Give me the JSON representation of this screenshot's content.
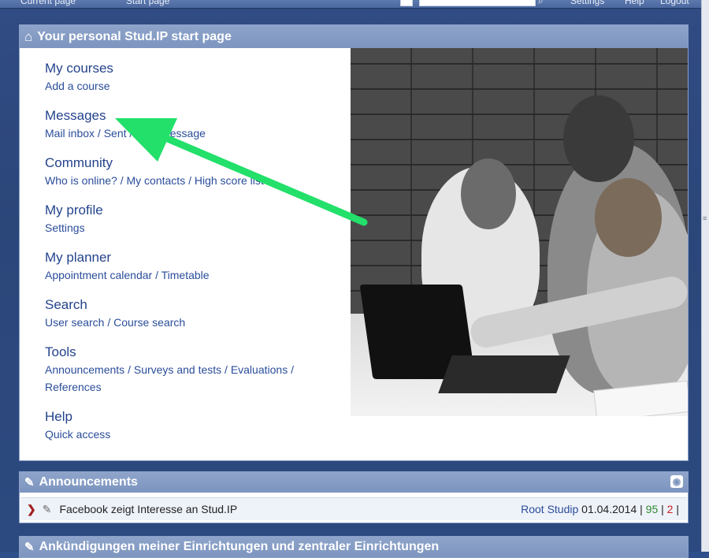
{
  "topbar": {
    "crumbs": [
      "Current page",
      "Start page"
    ],
    "links": [
      "Settings",
      "Help",
      "Logout"
    ]
  },
  "panel": {
    "title": "Your personal Stud.IP start page",
    "menu": [
      {
        "title": "My courses",
        "subs": [
          "Add a course"
        ]
      },
      {
        "title": "Messages",
        "subs": [
          "Mail inbox",
          "Sent",
          "New message"
        ]
      },
      {
        "title": "Community",
        "subs": [
          "Who is online?",
          "My contacts",
          "High score list"
        ]
      },
      {
        "title": "My profile",
        "subs": [
          "Settings"
        ]
      },
      {
        "title": "My planner",
        "subs": [
          "Appointment calendar",
          "Timetable"
        ]
      },
      {
        "title": "Search",
        "subs": [
          "User search",
          "Course search"
        ]
      },
      {
        "title": "Tools",
        "subs": [
          "Announcements",
          "Surveys and tests",
          "Evaluations",
          "References"
        ]
      },
      {
        "title": "Help",
        "subs": [
          "Quick access"
        ]
      }
    ]
  },
  "announcements": {
    "title": "Announcements",
    "row": {
      "text": "Facebook zeigt Interesse an Stud.IP",
      "author": "Root Studip",
      "date": "01.04.2014",
      "count_green": "95",
      "count_red": "2"
    }
  },
  "announcements2": {
    "title": "Ankündigungen meiner Einrichtungen und zentraler Einrichtungen"
  },
  "colors": {
    "accent": "#24438c",
    "header": "#7d95bf",
    "arrow": "#22e06a"
  }
}
